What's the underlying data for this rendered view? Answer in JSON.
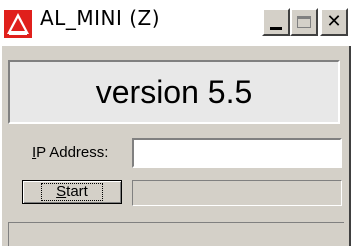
{
  "window": {
    "title": "AL_MINI (Z)",
    "icon": "al-logo-icon",
    "buttons": {
      "minimize": "minimize-icon",
      "maximize": "maximize-icon",
      "close": "close-icon"
    }
  },
  "main": {
    "version_text": "version 5.5",
    "ip_label_accel": "I",
    "ip_label_rest": "P Address:",
    "ip_value": "",
    "start_accel": "S",
    "start_rest": "tart",
    "status_text": ""
  },
  "colors": {
    "face": "#d4d0c8",
    "logo_red": "#e0201c"
  }
}
